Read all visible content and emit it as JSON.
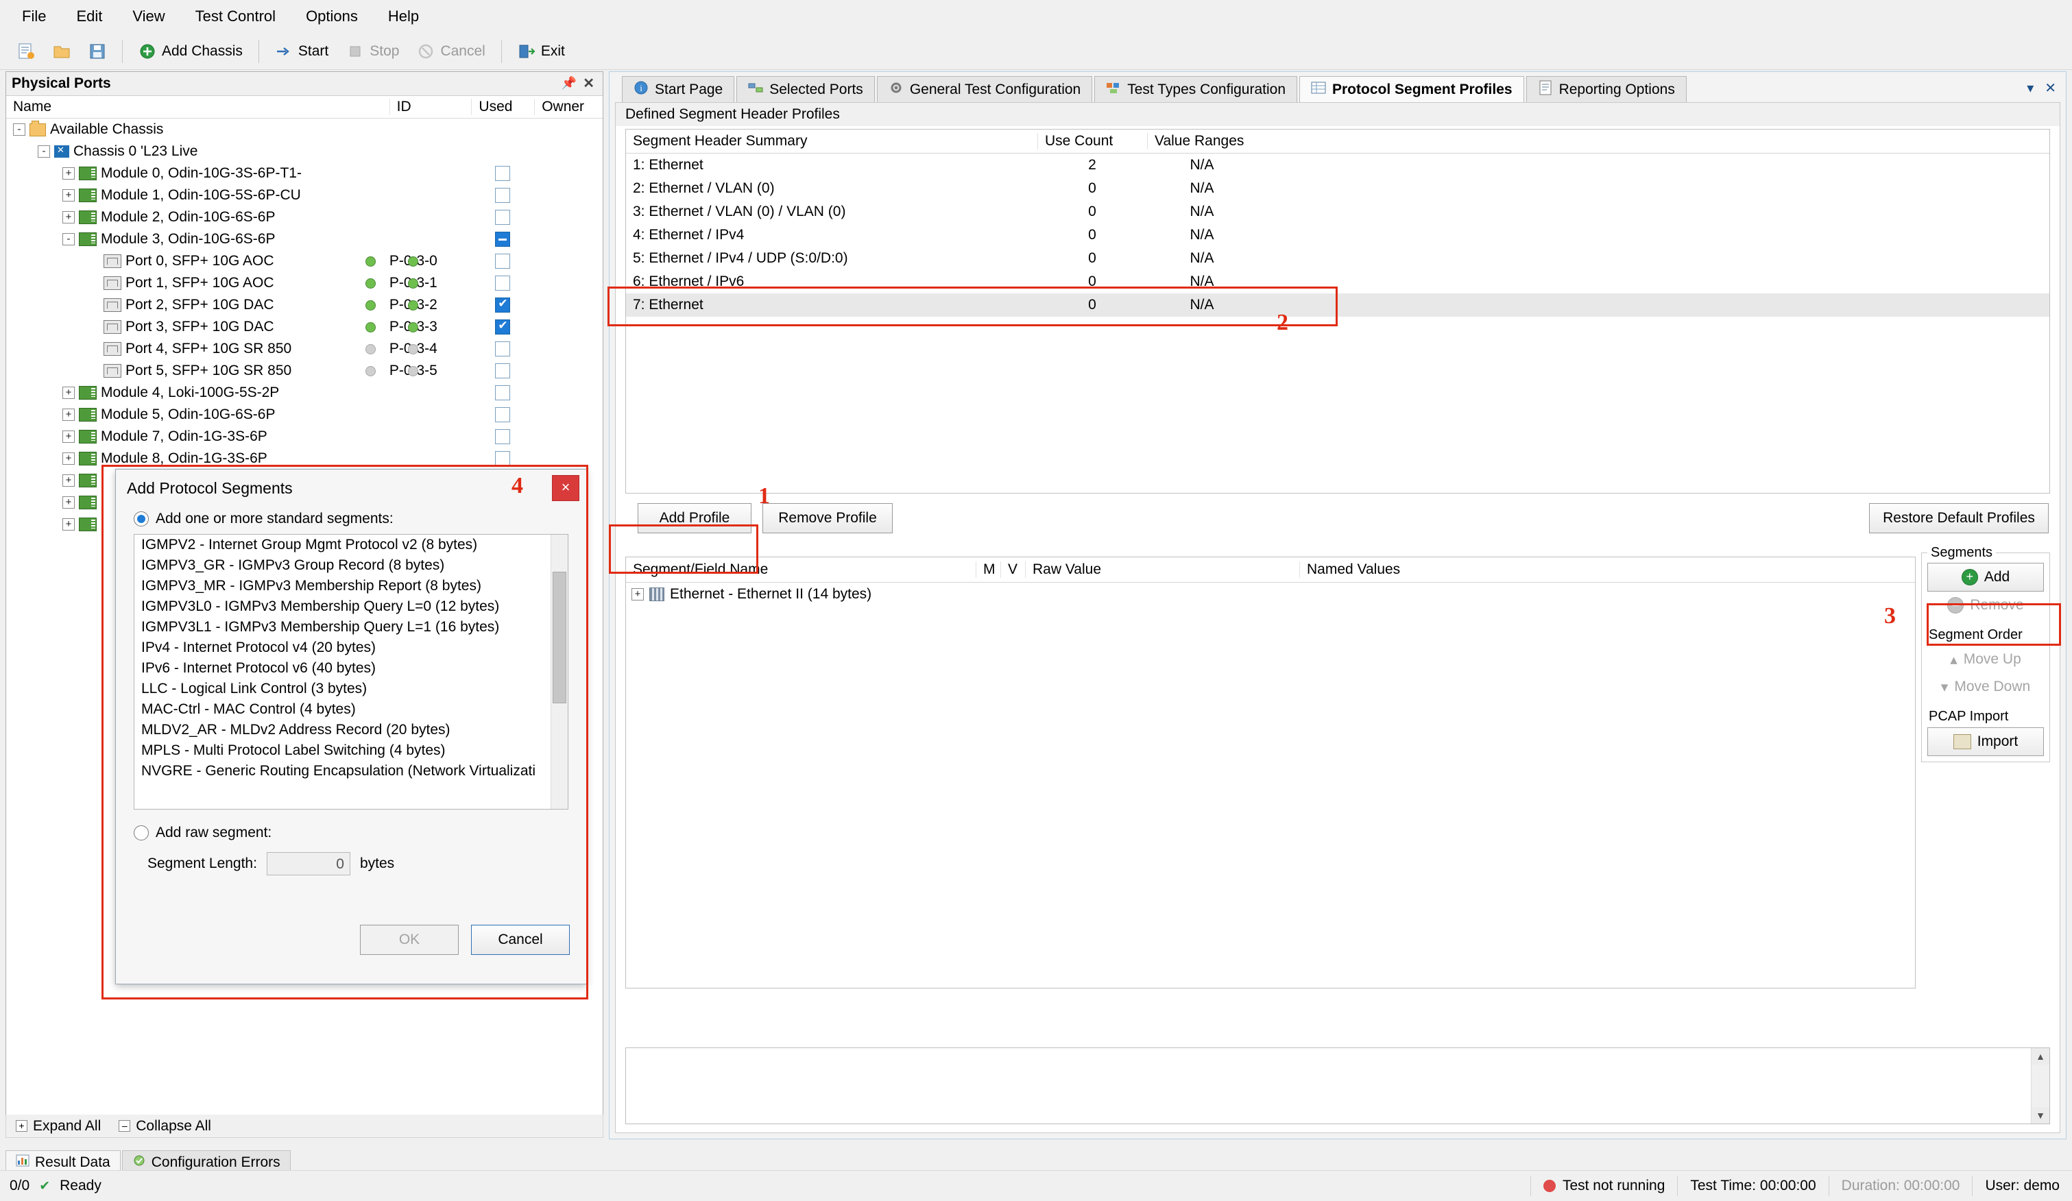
{
  "menubar": {
    "items": [
      "File",
      "Edit",
      "View",
      "Test Control",
      "Options",
      "Help"
    ]
  },
  "toolbar": {
    "new_label": "new-icon",
    "open_label": "open-icon",
    "save_label": "save-icon",
    "add_chassis": "Add Chassis",
    "start": "Start",
    "stop": "Stop",
    "cancel": "Cancel",
    "exit": "Exit"
  },
  "physical_ports": {
    "title": "Physical Ports",
    "columns": [
      "Name",
      "ID",
      "Used",
      "Owner"
    ],
    "rows": [
      {
        "indent": 0,
        "icon": "folder-icon",
        "expander": "-",
        "label": "Available Chassis",
        "id": "",
        "used": "none",
        "owner": ""
      },
      {
        "indent": 1,
        "icon": "chassis-icon",
        "expander": "-",
        "label": "Chassis 0 'L23 Live",
        "id": "",
        "used": "none",
        "owner": ""
      },
      {
        "indent": 2,
        "icon": "module-icon",
        "expander": "+",
        "label": "Module 0, Odin-10G-3S-6P-T1-",
        "id": "",
        "used": "unchecked",
        "owner": ""
      },
      {
        "indent": 2,
        "icon": "module-icon",
        "expander": "+",
        "label": "Module 1, Odin-10G-5S-6P-CU",
        "id": "",
        "used": "unchecked",
        "owner": ""
      },
      {
        "indent": 2,
        "icon": "module-icon",
        "expander": "+",
        "label": "Module 2, Odin-10G-6S-6P",
        "id": "",
        "used": "unchecked",
        "owner": ""
      },
      {
        "indent": 2,
        "icon": "module-icon",
        "expander": "-",
        "label": "Module 3, Odin-10G-6S-6P",
        "id": "",
        "used": "partial",
        "owner": ""
      },
      {
        "indent": 3,
        "icon": "port-icon",
        "expander": "",
        "label": "Port 0, SFP+ 10G AOC",
        "id": "P-0-3-0",
        "used": "unchecked",
        "owner": "",
        "led": "on"
      },
      {
        "indent": 3,
        "icon": "port-icon",
        "expander": "",
        "label": "Port 1, SFP+ 10G AOC",
        "id": "P-0-3-1",
        "used": "unchecked",
        "owner": "",
        "led": "on"
      },
      {
        "indent": 3,
        "icon": "port-icon",
        "expander": "",
        "label": "Port 2, SFP+ 10G DAC",
        "id": "P-0-3-2",
        "used": "checked",
        "owner": "",
        "led": "on"
      },
      {
        "indent": 3,
        "icon": "port-icon",
        "expander": "",
        "label": "Port 3, SFP+ 10G DAC",
        "id": "P-0-3-3",
        "used": "checked",
        "owner": "",
        "led": "on"
      },
      {
        "indent": 3,
        "icon": "port-icon",
        "expander": "",
        "label": "Port 4, SFP+ 10G SR 850",
        "id": "P-0-3-4",
        "used": "unchecked",
        "owner": "",
        "led": "dim"
      },
      {
        "indent": 3,
        "icon": "port-icon",
        "expander": "",
        "label": "Port 5, SFP+ 10G SR 850",
        "id": "P-0-3-5",
        "used": "unchecked",
        "owner": "",
        "led": "dim"
      },
      {
        "indent": 2,
        "icon": "module-icon",
        "expander": "+",
        "label": "Module 4, Loki-100G-5S-2P",
        "id": "",
        "used": "unchecked",
        "owner": ""
      },
      {
        "indent": 2,
        "icon": "module-icon",
        "expander": "+",
        "label": "Module 5, Odin-10G-6S-6P",
        "id": "",
        "used": "unchecked",
        "owner": ""
      },
      {
        "indent": 2,
        "icon": "module-icon",
        "expander": "+",
        "label": "Module 7, Odin-1G-3S-6P",
        "id": "",
        "used": "unchecked",
        "owner": ""
      },
      {
        "indent": 2,
        "icon": "module-icon",
        "expander": "+",
        "label": "Module 8, Odin-1G-3S-6P",
        "id": "",
        "used": "unchecked",
        "owner": ""
      },
      {
        "indent": 2,
        "icon": "module-icon",
        "expander": "+",
        "label": "",
        "id": "",
        "used": "unchecked",
        "owner": ""
      },
      {
        "indent": 2,
        "icon": "module-icon",
        "expander": "+",
        "label": "",
        "id": "",
        "used": "unchecked",
        "owner": ""
      },
      {
        "indent": 2,
        "icon": "module-icon",
        "expander": "+",
        "label": "",
        "id": "",
        "used": "unchecked",
        "owner": ""
      }
    ],
    "expand_all": "Expand All",
    "collapse_all": "Collapse All"
  },
  "bottom_tabs": [
    {
      "label": "Result Data",
      "active": true
    },
    {
      "label": "Configuration Errors",
      "active": false
    }
  ],
  "right_tabs": [
    {
      "label": "Start Page",
      "active": false,
      "icon": "info-icon"
    },
    {
      "label": "Selected Ports",
      "active": false,
      "icon": "ports-icon"
    },
    {
      "label": "General Test Configuration",
      "active": false,
      "icon": "gear-icon"
    },
    {
      "label": "Test Types Configuration",
      "active": false,
      "icon": "types-icon"
    },
    {
      "label": "Protocol Segment Profiles",
      "active": true,
      "icon": "segment-icon"
    },
    {
      "label": "Reporting Options",
      "active": false,
      "icon": "report-icon"
    }
  ],
  "profiles": {
    "section_label": "Defined Segment Header Profiles",
    "columns": [
      "Segment Header Summary",
      "Use Count",
      "Value Ranges"
    ],
    "rows": [
      {
        "summary": "1: Ethernet",
        "use_count": "2",
        "value_ranges": "N/A",
        "selected": false
      },
      {
        "summary": "2: Ethernet / VLAN (0)",
        "use_count": "0",
        "value_ranges": "N/A",
        "selected": false
      },
      {
        "summary": "3: Ethernet / VLAN (0) / VLAN (0)",
        "use_count": "0",
        "value_ranges": "N/A",
        "selected": false
      },
      {
        "summary": "4: Ethernet / IPv4",
        "use_count": "0",
        "value_ranges": "N/A",
        "selected": false
      },
      {
        "summary": "5: Ethernet / IPv4 / UDP (S:0/D:0)",
        "use_count": "0",
        "value_ranges": "N/A",
        "selected": false
      },
      {
        "summary": "6: Ethernet / IPv6",
        "use_count": "0",
        "value_ranges": "N/A",
        "selected": false
      },
      {
        "summary": "7: Ethernet",
        "use_count": "0",
        "value_ranges": "N/A",
        "selected": true
      }
    ],
    "add_profile": "Add Profile",
    "remove_profile": "Remove Profile",
    "restore_defaults": "Restore Default Profiles"
  },
  "segments": {
    "columns": [
      "Segment/Field Name",
      "M",
      "V",
      "Raw Value",
      "Named Values"
    ],
    "rows": [
      {
        "name": "Ethernet - Ethernet II (14 bytes)",
        "m": "",
        "v": "",
        "raw": "",
        "named": "",
        "expander": "+"
      }
    ],
    "panel_title": "Segments",
    "add": "Add",
    "remove": "Remove",
    "order_label": "Segment Order",
    "move_up": "Move Up",
    "move_down": "Move Down",
    "pcap_label": "PCAP Import",
    "import": "Import"
  },
  "dialog": {
    "title": "Add Protocol Segments",
    "standard_radio": "Add one or more standard segments:",
    "raw_radio": "Add raw segment:",
    "segment_length_label": "Segment Length:",
    "segment_length_value": "0",
    "bytes_label": "bytes",
    "ok": "OK",
    "cancel": "Cancel",
    "close": "×",
    "items": [
      "IGMPV2 - Internet Group Mgmt Protocol v2 (8 bytes)",
      "IGMPV3_GR - IGMPv3 Group Record (8 bytes)",
      "IGMPV3_MR - IGMPv3 Membership Report (8 bytes)",
      "IGMPV3L0 - IGMPv3 Membership Query L=0 (12 bytes)",
      "IGMPV3L1 - IGMPv3 Membership Query L=1 (16 bytes)",
      "IPv4 - Internet Protocol v4 (20 bytes)",
      "IPv6 - Internet Protocol v6 (40 bytes)",
      "LLC - Logical Link Control (3 bytes)",
      "MAC-Ctrl - MAC Control (4 bytes)",
      "MLDV2_AR - MLDv2 Address Record (20 bytes)",
      "MPLS - Multi Protocol Label Switching (4 bytes)",
      "NVGRE - Generic Routing Encapsulation (Network Virtualizati"
    ]
  },
  "annotations": [
    {
      "number": "1"
    },
    {
      "number": "2"
    },
    {
      "number": "3"
    },
    {
      "number": "4"
    }
  ],
  "statusbar": {
    "counter": "0/0",
    "ready": "Ready",
    "test_state": "Test not running",
    "test_time": "Test Time: 00:00:00",
    "duration": "Duration: 00:00:00",
    "user": "User: demo"
  },
  "colors": {
    "annotation": "#e02b14",
    "accent": "#1e7bd6",
    "ok": "#2e9b43",
    "error": "#d93a3a"
  }
}
